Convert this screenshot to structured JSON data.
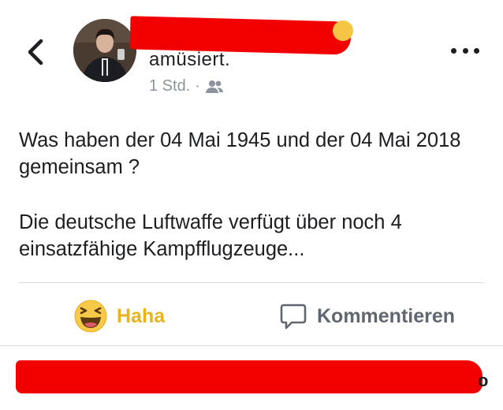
{
  "post": {
    "action": "amüsiert.",
    "time": "1 Std.",
    "dot": "·",
    "icons": {
      "back": "chevron-left-icon",
      "audience": "friends-icon",
      "more": "more-dots-icon"
    },
    "paragraphs": [
      "Was haben der 04 Mai 1945 und der 04 Mai 2018 gemeinsam ?",
      "Die deutsche Luftwaffe verfügt über noch 4 einsatzfähige Kampfflugzeuge..."
    ]
  },
  "actions": {
    "haha_label": "Haha",
    "comment_label": "Kommentieren",
    "haha_icon": "haha-emoji-icon",
    "comment_icon": "comment-bubble-icon"
  },
  "footer": {
    "trailing_text": "o"
  },
  "colors": {
    "haha": "#e9b31b",
    "redaction": "#f20000",
    "muted": "#8d949e"
  }
}
